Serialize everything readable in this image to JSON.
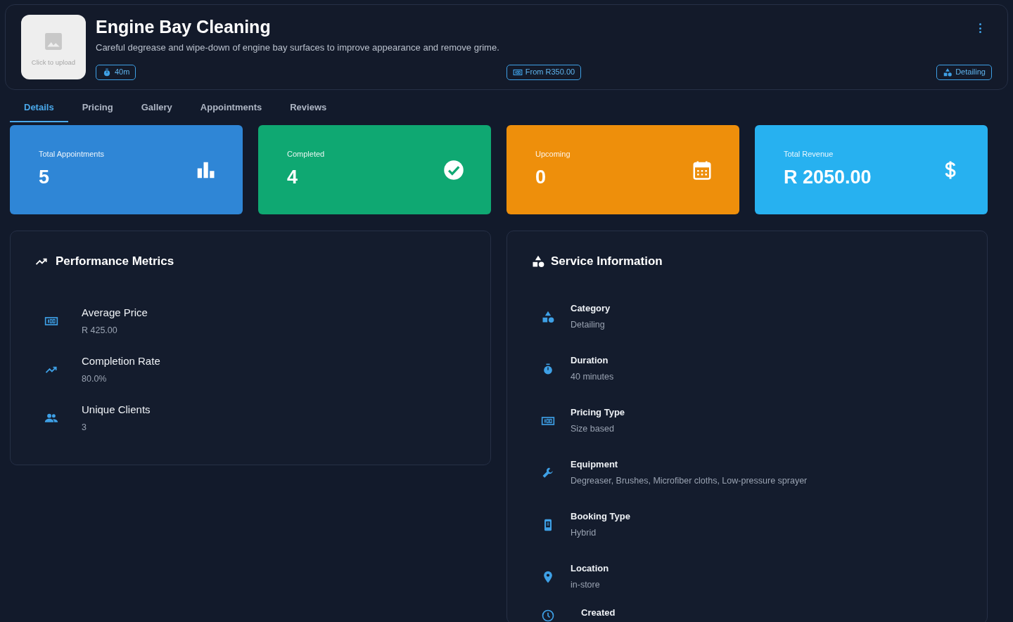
{
  "header": {
    "upload_label": "Click to upload",
    "title": "Engine Bay Cleaning",
    "description": "Careful degrease and wipe-down of engine bay surfaces to improve appearance and remove grime.",
    "chips": [
      {
        "kind": "duration",
        "label": "40m"
      },
      {
        "kind": "price",
        "label": "From R350.00"
      },
      {
        "kind": "category",
        "label": "Detailing"
      }
    ]
  },
  "tabs": [
    {
      "label": "Details",
      "selected": true
    },
    {
      "label": "Pricing",
      "selected": false
    },
    {
      "label": "Gallery",
      "selected": false
    },
    {
      "label": "Appointments",
      "selected": false
    },
    {
      "label": "Reviews",
      "selected": false
    }
  ],
  "stats": [
    {
      "kind": "chart",
      "label": "Total Appointments",
      "value": "5",
      "color": "#2f86d6"
    },
    {
      "kind": "check",
      "label": "Completed",
      "value": "4",
      "color": "#0fa872"
    },
    {
      "kind": "calendar",
      "label": "Upcoming",
      "value": "0",
      "color": "#ee8f0b"
    },
    {
      "kind": "dollar",
      "label": "Total Revenue",
      "value": "R 2050.00",
      "color": "#27b1f0"
    }
  ],
  "performance": {
    "title": "Performance Metrics",
    "items": [
      {
        "kind": "money",
        "label": "Average Price",
        "value": "R 425.00"
      },
      {
        "kind": "trend",
        "label": "Completion Rate",
        "value": "80.0%"
      },
      {
        "kind": "people",
        "label": "Unique Clients",
        "value": "3"
      }
    ]
  },
  "service_info": {
    "title": "Service Information",
    "items": [
      {
        "kind": "category",
        "label": "Category",
        "value": "Detailing"
      },
      {
        "kind": "timer",
        "label": "Duration",
        "value": "40 minutes"
      },
      {
        "kind": "money",
        "label": "Pricing Type",
        "value": "Size based"
      },
      {
        "kind": "wrench",
        "label": "Equipment",
        "value": "Degreaser, Brushes, Microfiber cloths, Low-pressure sprayer"
      },
      {
        "kind": "booking",
        "label": "Booking Type",
        "value": "Hybrid"
      },
      {
        "kind": "pin",
        "label": "Location",
        "value": "in-store"
      },
      {
        "kind": "clock",
        "label": "Created"
      }
    ]
  }
}
